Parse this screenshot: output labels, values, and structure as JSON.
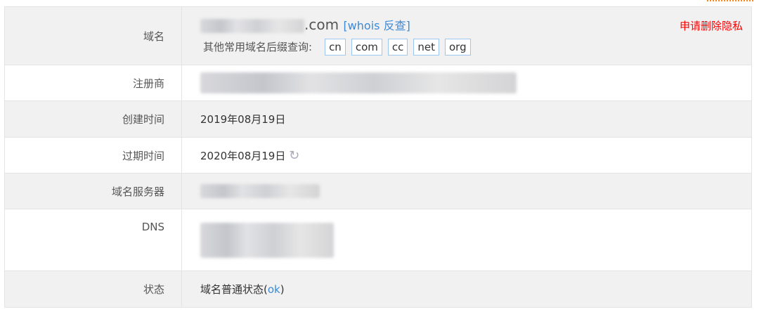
{
  "domain": {
    "label": "域名",
    "suffix": ".com",
    "whois_link": "[whois 反查]",
    "other_label": "其他常用域名后缀查询:",
    "suffixes": [
      "cn",
      "com",
      "cc",
      "net",
      "org"
    ],
    "privacy_link": "申请删除隐私"
  },
  "registrar": {
    "label": "注册商"
  },
  "created": {
    "label": "创建时间",
    "value": "2019年08月19日"
  },
  "expires": {
    "label": "过期时间",
    "value": "2020年08月19日",
    "icon": "refresh-icon"
  },
  "nameserver": {
    "label": "域名服务器"
  },
  "dns": {
    "label": "DNS"
  },
  "status": {
    "label": "状态",
    "prefix": "域名普通状态(",
    "code": "ok",
    "suffix": ")"
  },
  "colors": {
    "link": "#3b8ad9",
    "privacy": "#ff0000"
  }
}
